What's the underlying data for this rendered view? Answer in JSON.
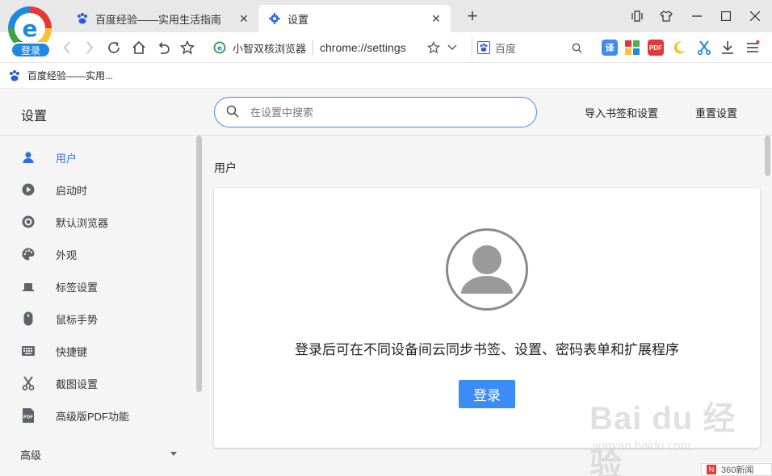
{
  "browser": {
    "login_badge": "登录",
    "logo_letter": "e",
    "tabs": [
      {
        "title": "百度经验——实用生活指南",
        "active": false,
        "icon": "baidu-paw-icon"
      },
      {
        "title": "设置",
        "active": true,
        "icon": "gear-icon"
      }
    ]
  },
  "toolbar": {
    "site_name": "小智双核浏览器",
    "url": "chrome://settings",
    "search_engine": "百度"
  },
  "extensions": [
    {
      "name": "translate-icon",
      "label": "译",
      "color": "#3c8cf5"
    },
    {
      "name": "apps-icon",
      "label": "",
      "color": "#4caf50"
    },
    {
      "name": "pdf-icon",
      "label": "PDF",
      "color": "#e53935"
    },
    {
      "name": "moon-icon",
      "label": "",
      "color": "#fbc02d"
    },
    {
      "name": "screenshot-scissors-icon",
      "label": "",
      "color": "#1e88e5"
    }
  ],
  "bookmarks": [
    {
      "label": "百度经验——实用..."
    }
  ],
  "settings": {
    "title": "设置",
    "search_placeholder": "在设置中搜索",
    "import_label": "导入书签和设置",
    "reset_label": "重置设置"
  },
  "sidebar": {
    "items": [
      {
        "label": "用户",
        "icon": "person-icon",
        "active": true
      },
      {
        "label": "启动时",
        "icon": "play-icon",
        "active": false
      },
      {
        "label": "默认浏览器",
        "icon": "target-icon",
        "active": false
      },
      {
        "label": "外观",
        "icon": "palette-icon",
        "active": false
      },
      {
        "label": "标签设置",
        "icon": "tab-icon",
        "active": false
      },
      {
        "label": "鼠标手势",
        "icon": "mouse-icon",
        "active": false
      },
      {
        "label": "快捷键",
        "icon": "keyboard-icon",
        "active": false
      },
      {
        "label": "截图设置",
        "icon": "scissors-icon",
        "active": false
      },
      {
        "label": "高级版PDF功能",
        "icon": "pdf-icon",
        "active": false
      }
    ],
    "advanced_label": "高级"
  },
  "main": {
    "section_title": "用户",
    "sync_text": "登录后可在不同设备间云同步书签、设置、密码表单和扩展程序",
    "login_button": "登录"
  },
  "watermark": {
    "brand": "Bai du 经验",
    "domain": "jingyan.baidu.com"
  },
  "news_badge": {
    "label": "360新闻"
  },
  "colors": {
    "accent": "#3c8cf5",
    "active_nav": "#2d6ee6",
    "sidebar_bg": "#f5f5f5"
  }
}
